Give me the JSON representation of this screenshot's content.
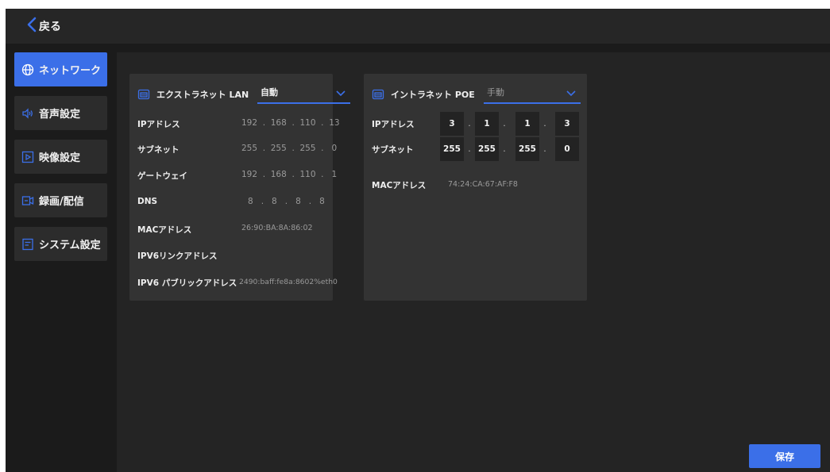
{
  "topbar": {
    "back_label": "戻る"
  },
  "sidebar": {
    "items": [
      {
        "label": "ネットワーク",
        "icon": "globe-icon",
        "active": true
      },
      {
        "label": "音声設定",
        "icon": "speaker-icon",
        "active": false
      },
      {
        "label": "映像設定",
        "icon": "play-icon",
        "active": false
      },
      {
        "label": "録画/配信",
        "icon": "record-icon",
        "active": false
      },
      {
        "label": "システム設定",
        "icon": "settings-doc-icon",
        "active": false
      }
    ]
  },
  "extranet": {
    "title": "エクストラネット LAN",
    "mode": "自動",
    "rows": [
      {
        "label": "IPアドレス",
        "value": "192  .  168  .  110  .  13"
      },
      {
        "label": "サブネット",
        "value": "255  .  255  .  255  .   0"
      },
      {
        "label": "ゲートウェイ",
        "value": "192  .  168  .  110  .   1"
      },
      {
        "label": "DNS",
        "value": "8   .   8   .   8   .   8"
      },
      {
        "label": "MACアドレス",
        "value": "26:90:BA:8A:86:02"
      },
      {
        "label": "IPV6リンクアドレス",
        "value": ""
      },
      {
        "label": "IPV6 パブリックアドレス",
        "value": "2490:baff:fe8a:8602%eth0"
      }
    ]
  },
  "intranet": {
    "title": "イントラネット POE",
    "mode": "手動",
    "ip_label": "IPアドレス",
    "ip": [
      "3",
      "1",
      "1",
      "3"
    ],
    "subnet_label": "サブネット",
    "subnet": [
      "255",
      "255",
      "255",
      "0"
    ],
    "mac_label": "MACアドレス",
    "mac": "74:24:CA:67:AF:F8"
  },
  "footer": {
    "save_label": "保存"
  },
  "colors": {
    "accent": "#3b6fe8",
    "background": "#1b1b1b",
    "panel": "#333333"
  }
}
